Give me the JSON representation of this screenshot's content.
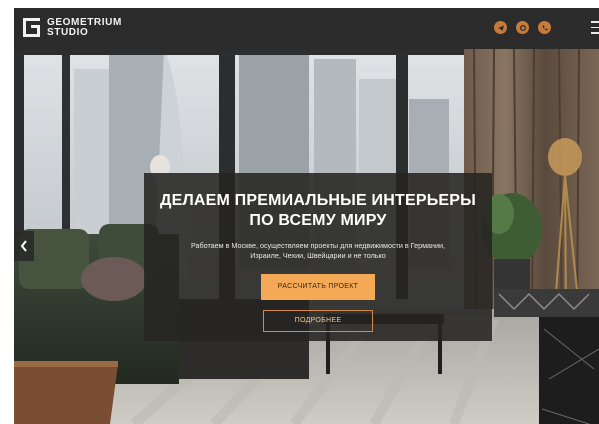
{
  "header": {
    "logo_line1": "GEOMETRIUM",
    "logo_line2": "STUDIO",
    "social": [
      {
        "name": "telegram-icon"
      },
      {
        "name": "viber-icon"
      },
      {
        "name": "phone-icon"
      }
    ],
    "menu_icon": "hamburger-menu-icon"
  },
  "hero": {
    "title_line1": "ДЕЛАЕМ ПРЕМИАЛЬНЫЕ ИНТЕРЬЕРЫ",
    "title_line2": "ПО ВСЕМУ МИРУ",
    "subtitle_line1": "Работаем в Москве, осуществляем проекты для недвижимости в Германии,",
    "subtitle_line2": "Израиле, Чехии, Швейцарии и не только",
    "primary_button": "РАССЧИТАТЬ ПРОЕКТ",
    "secondary_button": "ПОДРОБНЕЕ"
  },
  "colors": {
    "accent": "#f3a955",
    "header_bg": "#2b2b2b",
    "social_icon_bg": "#c87a3a"
  }
}
